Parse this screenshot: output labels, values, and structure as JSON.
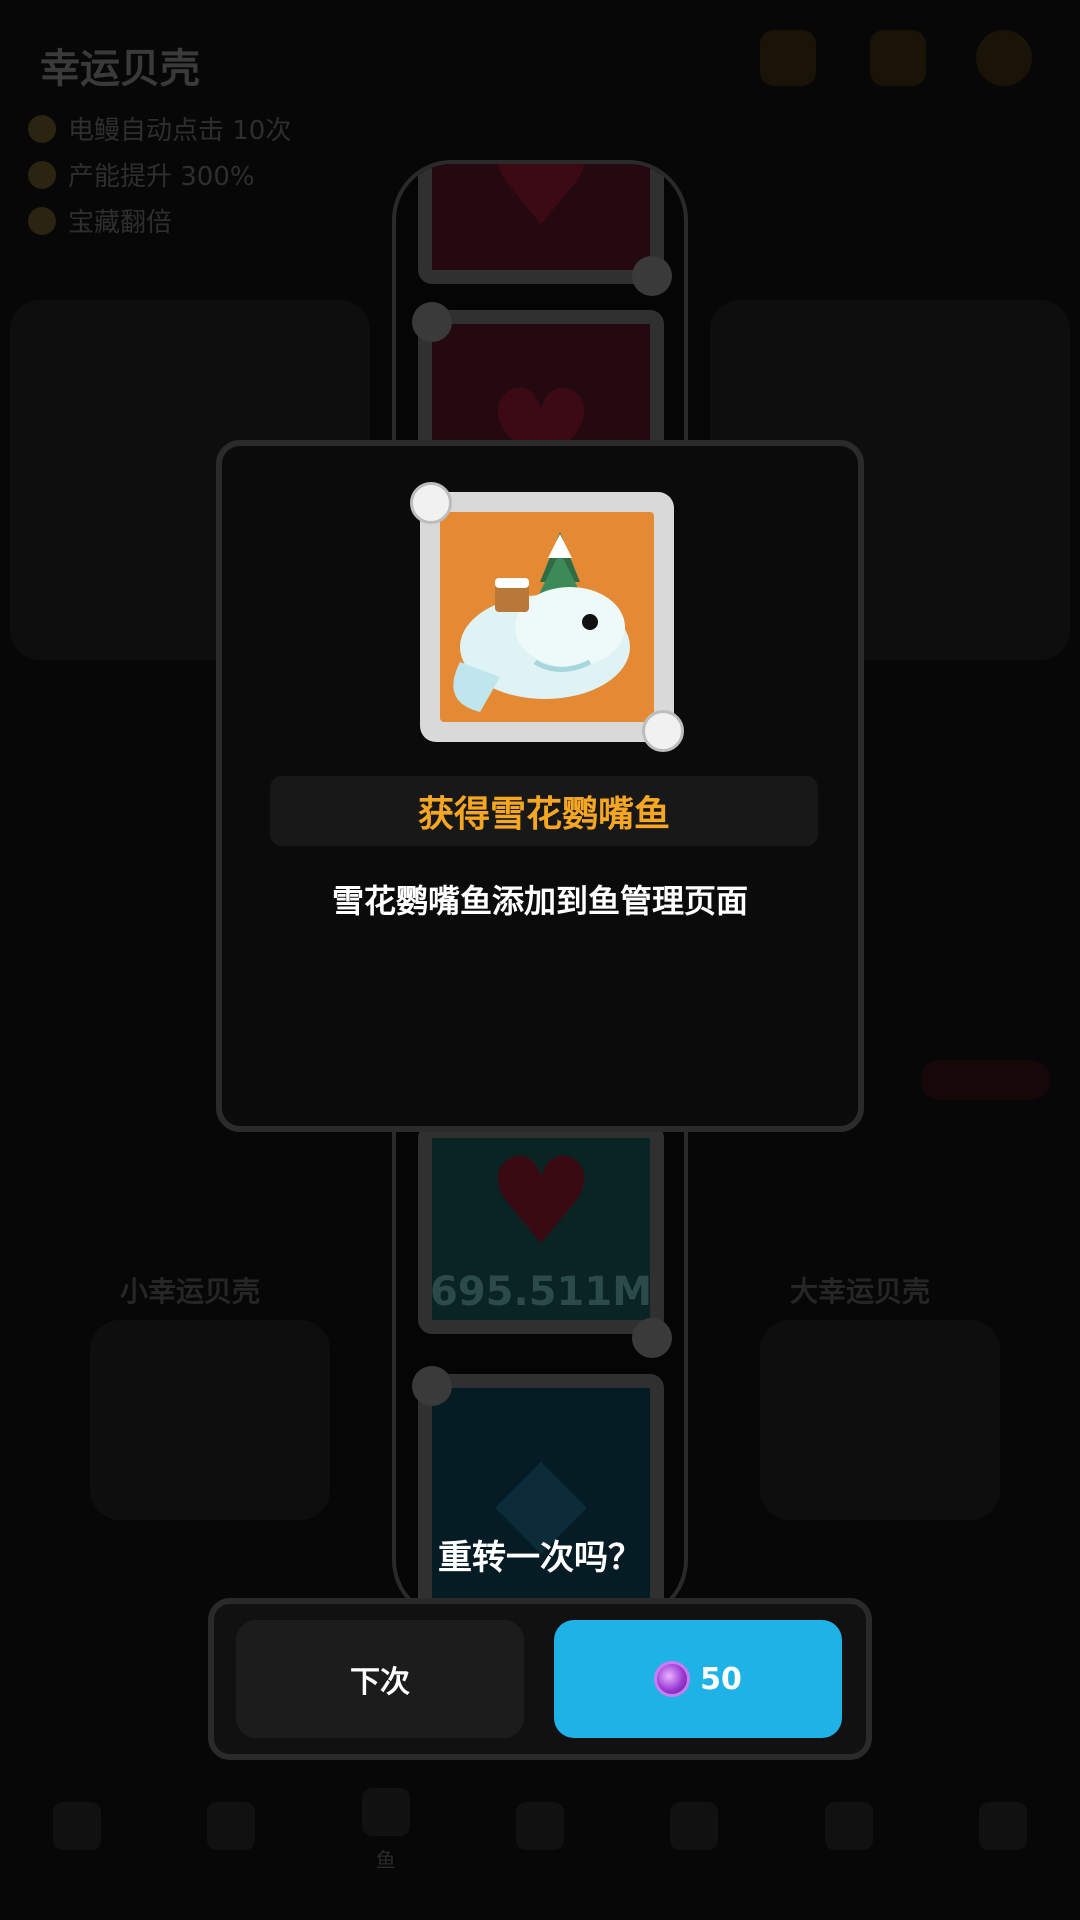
{
  "background": {
    "title": "幸运贝壳",
    "stats": [
      "电鳗自动点击 10次",
      "产能提升 300%",
      "宝藏翻倍"
    ],
    "left_box_label": "小幸运贝壳",
    "right_box_label": "大幸运贝壳",
    "nav": [
      "",
      "",
      "鱼",
      "",
      "",
      "",
      ""
    ]
  },
  "reel": {
    "card_value": "695.511M"
  },
  "dialog": {
    "title": "获得雪花鹦嘴鱼",
    "description": "雪花鹦嘴鱼添加到鱼管理页面",
    "reward_icon": "snowflake-parrotfish-icon"
  },
  "prompt": {
    "respin_question": "重转一次吗？"
  },
  "buttons": {
    "next_label": "下次",
    "respin_cost": "50",
    "respin_color": "#1eb2e6",
    "currency_icon": "pearl-icon"
  }
}
